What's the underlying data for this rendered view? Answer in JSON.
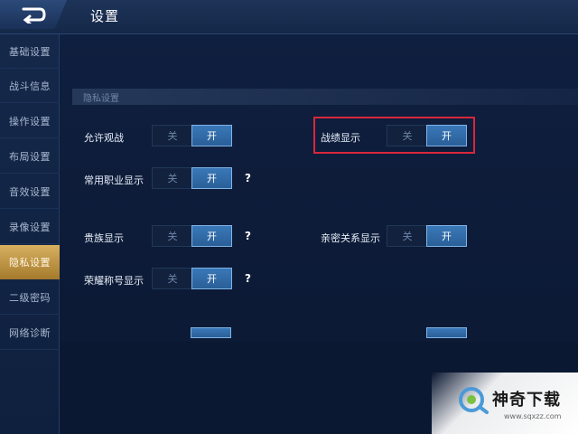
{
  "header": {
    "title": "设置",
    "back_icon": "back-arrow-icon"
  },
  "sidebar": {
    "items": [
      {
        "label": "基础设置",
        "active": false
      },
      {
        "label": "战斗信息",
        "active": false
      },
      {
        "label": "操作设置",
        "active": false
      },
      {
        "label": "布局设置",
        "active": false
      },
      {
        "label": "音效设置",
        "active": false
      },
      {
        "label": "录像设置",
        "active": false
      },
      {
        "label": "隐私设置",
        "active": true
      },
      {
        "label": "二级密码",
        "active": false
      },
      {
        "label": "网络诊断",
        "active": false
      }
    ]
  },
  "section": {
    "title": "隐私设置"
  },
  "settings": {
    "allow_spectate": {
      "label": "允许观战",
      "off": "关",
      "on": "开",
      "value": "开"
    },
    "record_display": {
      "label": "战绩显示",
      "off": "关",
      "on": "开",
      "value": "开"
    },
    "common_role": {
      "label": "常用职业显示",
      "off": "关",
      "on": "开",
      "value": "开",
      "help": "?"
    },
    "noble_display": {
      "label": "贵族显示",
      "off": "关",
      "on": "开",
      "value": "开",
      "help": "?"
    },
    "intimate_display": {
      "label": "亲密关系显示",
      "off": "关",
      "on": "开",
      "value": "开"
    },
    "honor_title": {
      "label": "荣耀称号显示",
      "off": "关",
      "on": "开",
      "value": "开",
      "help": "?"
    }
  },
  "watermark": {
    "name": "神奇下载",
    "url": "www.sqxzz.com"
  },
  "colors": {
    "accent_on": "#3a78b8",
    "active_tab": "#c9a04e",
    "highlight": "#d9273c",
    "background": "#0d1a33"
  }
}
